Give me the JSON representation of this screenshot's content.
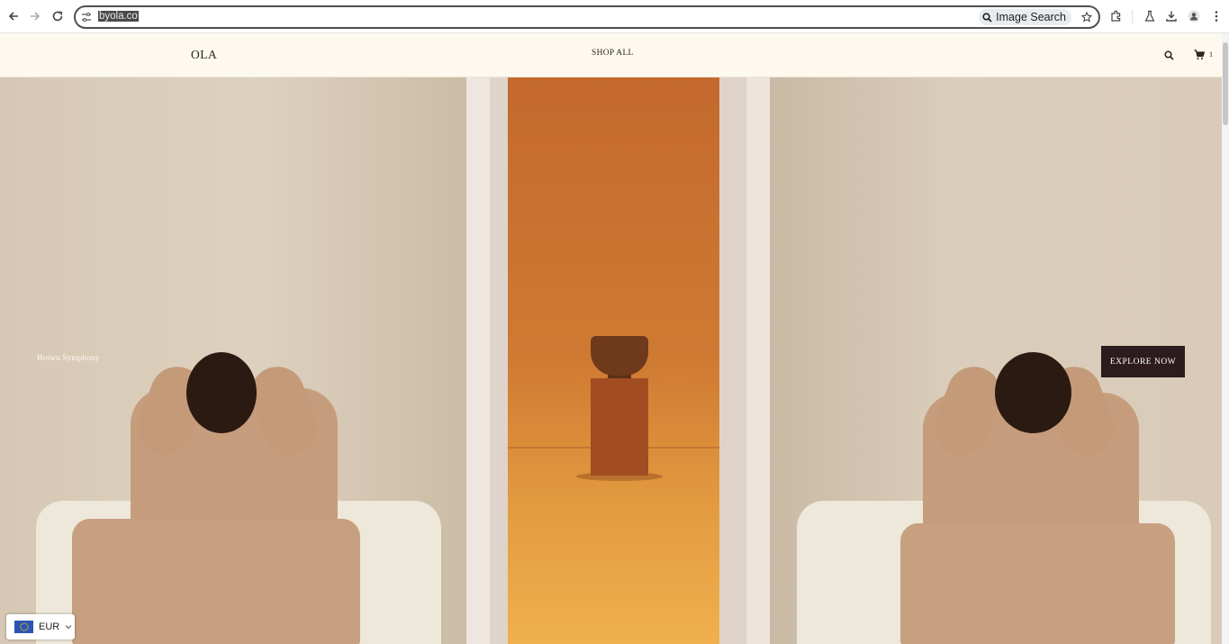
{
  "browser": {
    "url": "byola.co",
    "image_search_label": "Image Search"
  },
  "header": {
    "logo": "OLA",
    "nav_shop_all": "SHOP ALL",
    "cart_count": "1"
  },
  "hero": {
    "caption": "Brown Symphony",
    "cta_label": "EXPLORE NOW"
  },
  "currency": {
    "selected": "EUR",
    "flag_icon": "eu-flag-icon"
  },
  "colors": {
    "header_bg": "#fdf9ee",
    "cta_bg": "#2c1c1e",
    "corridor_orange": "#cf7a33"
  }
}
